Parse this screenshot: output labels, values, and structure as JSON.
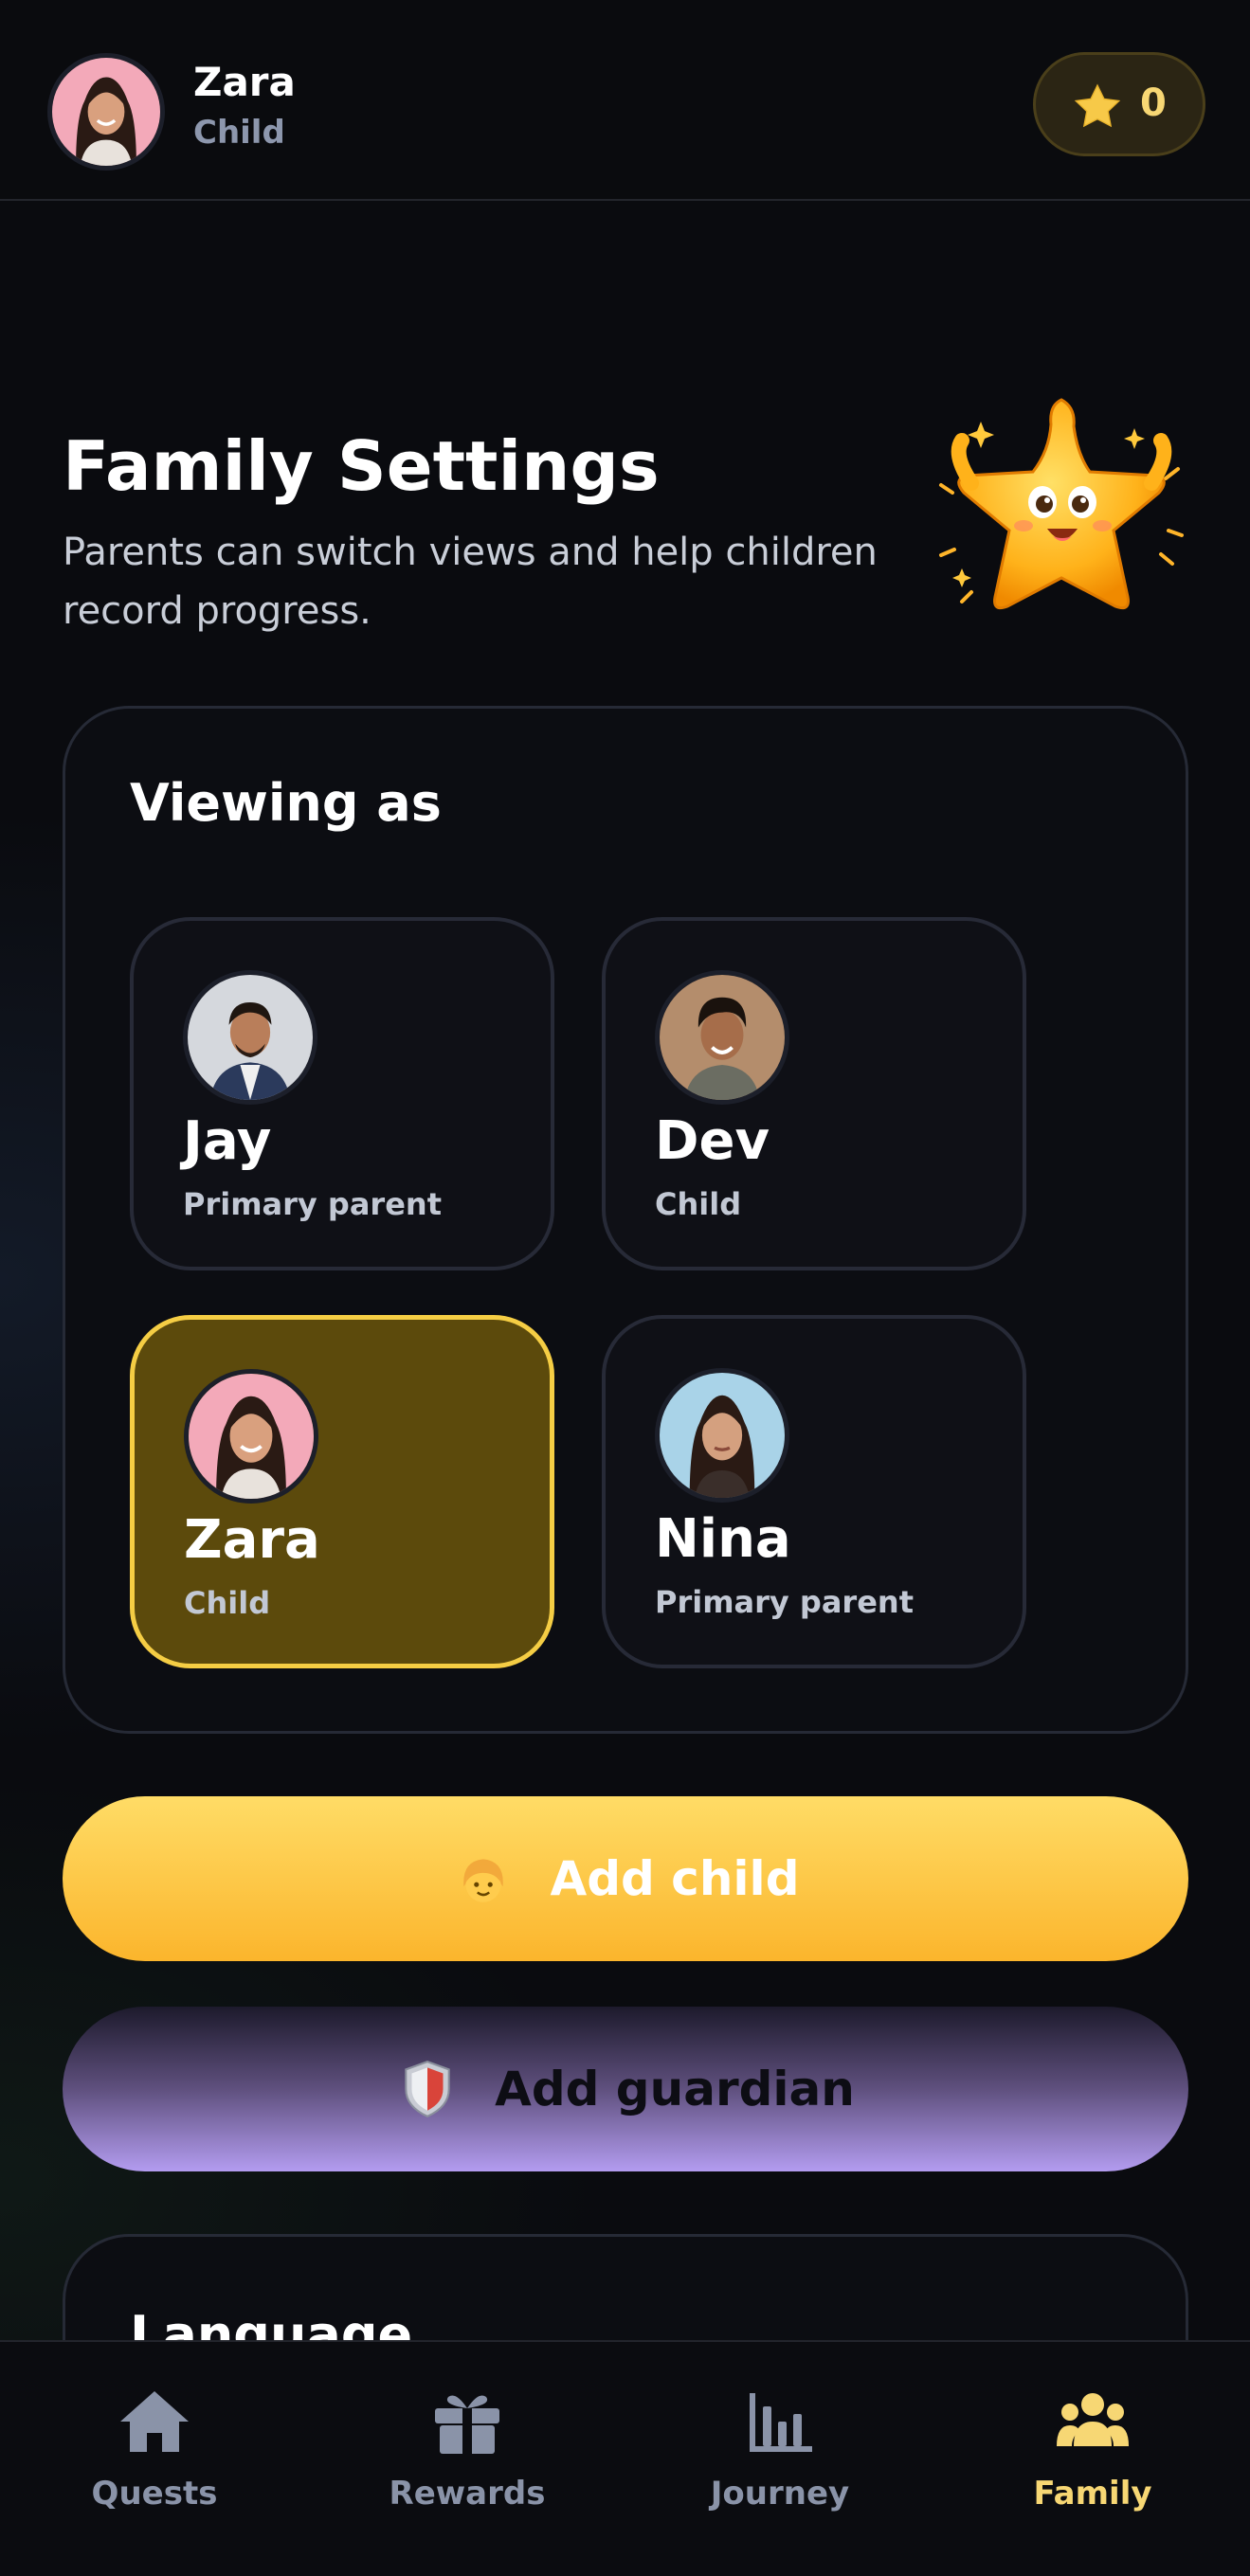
{
  "header": {
    "user_name": "Zara",
    "user_role": "Child",
    "star_count": "0"
  },
  "page": {
    "title": "Family Settings",
    "subtitle": "Parents can switch views and help children record progress."
  },
  "viewing_as": {
    "title": "Viewing as",
    "profiles": [
      {
        "name": "Jay",
        "role": "Primary parent",
        "selected": false
      },
      {
        "name": "Dev",
        "role": "Child",
        "selected": false
      },
      {
        "name": "Zara",
        "role": "Child",
        "selected": true
      },
      {
        "name": "Nina",
        "role": "Primary parent",
        "selected": false
      }
    ]
  },
  "buttons": {
    "add_child": "Add child",
    "add_guardian": "Add guardian"
  },
  "language_card": {
    "title": "Language"
  },
  "nav": {
    "items": [
      {
        "label": "Quests",
        "icon": "home-icon",
        "active": false
      },
      {
        "label": "Rewards",
        "icon": "gift-icon",
        "active": false
      },
      {
        "label": "Journey",
        "icon": "bar-chart-icon",
        "active": false
      },
      {
        "label": "Family",
        "icon": "family-icon",
        "active": true
      }
    ]
  },
  "colors": {
    "accent_yellow": "#f5cd44",
    "selected_bg": "#5c4a0c",
    "guardian_purple": "#b39cf0",
    "nav_active": "#f7d774",
    "nav_inactive": "#8a93a8"
  }
}
